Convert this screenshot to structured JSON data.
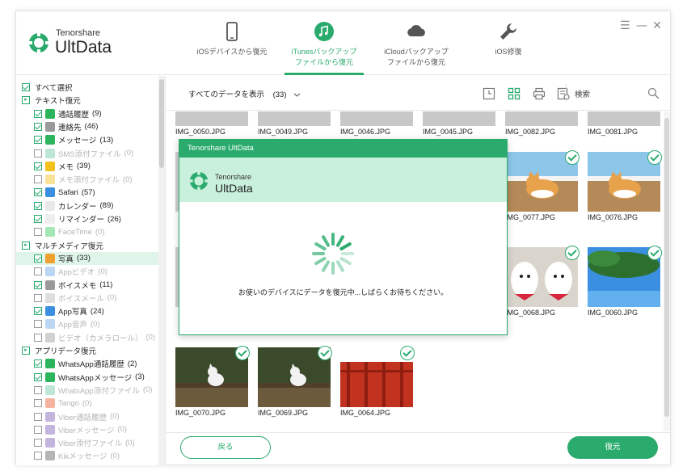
{
  "app": {
    "logo_small": "Tenorshare",
    "logo_big": "UltData"
  },
  "nav": {
    "tabs": [
      {
        "label": "iOSデバイスから復元",
        "icon": "phone-icon"
      },
      {
        "label": "iTunesバックアップ\nファイルから復元",
        "icon": "music-note-icon",
        "active": true
      },
      {
        "label": "iCloudバックアップ\nファイルから復元",
        "icon": "cloud-icon"
      },
      {
        "label": "iOS修復",
        "icon": "wrench-icon"
      }
    ]
  },
  "window_controls": {
    "menu": "☰",
    "minimize": "—",
    "close": "✕"
  },
  "sidebar": {
    "select_all": "すべて選択",
    "sections": [
      {
        "label": "テキスト復元",
        "items": [
          {
            "label": "通話履歴",
            "count": "(9)",
            "checked": true,
            "enabled": true,
            "icon_color": "#2db55d"
          },
          {
            "label": "連絡先",
            "count": "(46)",
            "checked": true,
            "enabled": true,
            "icon_color": "#9a9a9a"
          },
          {
            "label": "メッセージ",
            "count": "(13)",
            "checked": true,
            "enabled": true,
            "icon_color": "#2db55d"
          },
          {
            "label": "SMS添付ファイル",
            "count": "(0)",
            "checked": false,
            "enabled": false,
            "icon_color": "#6fc8a0"
          },
          {
            "label": "メモ",
            "count": "(39)",
            "checked": true,
            "enabled": true,
            "icon_color": "#f3c11b"
          },
          {
            "label": "メモ添付ファイル",
            "count": "(0)",
            "checked": false,
            "enabled": false,
            "icon_color": "#f3c11b"
          },
          {
            "label": "Safari",
            "count": "(57)",
            "checked": true,
            "enabled": true,
            "icon_color": "#3b8fe0"
          },
          {
            "label": "カレンダー",
            "count": "(89)",
            "checked": true,
            "enabled": true,
            "icon_color": "#e8e8e8"
          },
          {
            "label": "リマインダー",
            "count": "(26)",
            "checked": true,
            "enabled": true,
            "icon_color": "#eeeeee"
          },
          {
            "label": "FaceTime",
            "count": "(0)",
            "checked": false,
            "enabled": false,
            "icon_color": "#35c759"
          }
        ]
      },
      {
        "label": "マルチメディア復元",
        "items": [
          {
            "label": "写真",
            "count": "(33)",
            "checked": true,
            "enabled": true,
            "selected": true,
            "icon_color": "#f0a030"
          },
          {
            "label": "Appビデオ",
            "count": "(0)",
            "checked": false,
            "enabled": false,
            "icon_color": "#6aa7e6"
          },
          {
            "label": "ボイスメモ",
            "count": "(11)",
            "checked": true,
            "enabled": true,
            "icon_color": "#9a9a9a"
          },
          {
            "label": "ボイスメール",
            "count": "(0)",
            "checked": false,
            "enabled": false,
            "icon_color": "#b9b9b9"
          },
          {
            "label": "App写真",
            "count": "(24)",
            "checked": true,
            "enabled": true,
            "icon_color": "#3b8fe0"
          },
          {
            "label": "App音声",
            "count": "(0)",
            "checked": false,
            "enabled": false,
            "icon_color": "#6aa7e6"
          },
          {
            "label": "ビデオ（カメラロール）",
            "count": "(0)",
            "checked": false,
            "enabled": false,
            "icon_color": "#9a9a9a"
          }
        ]
      },
      {
        "label": "アプリデータ復元",
        "items": [
          {
            "label": "WhatsApp通話履歴",
            "count": "(2)",
            "checked": true,
            "enabled": true,
            "icon_color": "#2db55d"
          },
          {
            "label": "WhatsAppメッセージ",
            "count": "(3)",
            "checked": true,
            "enabled": true,
            "icon_color": "#2db55d"
          },
          {
            "label": "WhatsApp添付ファイル",
            "count": "(0)",
            "checked": false,
            "enabled": false,
            "icon_color": "#6fc8a0"
          },
          {
            "label": "Tango",
            "count": "(0)",
            "checked": false,
            "enabled": false,
            "icon_color": "#e8542b"
          },
          {
            "label": "Viber通話履歴",
            "count": "(0)",
            "checked": false,
            "enabled": false,
            "icon_color": "#7b5bb6"
          },
          {
            "label": "Viberメッセージ",
            "count": "(0)",
            "checked": false,
            "enabled": false,
            "icon_color": "#7b5bb6"
          },
          {
            "label": "Viber添付ファイル",
            "count": "(0)",
            "checked": false,
            "enabled": false,
            "icon_color": "#7b5bb6"
          },
          {
            "label": "Kikメッセージ",
            "count": "(0)",
            "checked": false,
            "enabled": false,
            "icon_color": "#5a5a5a"
          }
        ]
      }
    ]
  },
  "toolbar": {
    "filter_label": "すべてのデータを表示",
    "filter_count": "(33)",
    "search_placeholder": "検索"
  },
  "photos": {
    "top_row_names": [
      "IMG_0050.JPG",
      "IMG_0049.JPG",
      "IMG_0046.JPG",
      "IMG_0045.JPG",
      "IMG_0082.JPG",
      "IMG_0081.JPG"
    ],
    "rows": [
      [
        {
          "name": "IMG_0077.JPG",
          "kind": "cat-floor"
        },
        {
          "name": "IMG_0076.JPG",
          "kind": "cat-floor"
        }
      ],
      [
        {
          "name": "IMG_0068.JPG",
          "kind": "dogs"
        },
        {
          "name": "IMG_0060.JPG",
          "kind": "sky-tree"
        }
      ],
      [
        {
          "name": "IMG_0070.JPG",
          "kind": "cat-grass"
        },
        {
          "name": "IMG_0069.JPG",
          "kind": "cat-grass"
        },
        {
          "name": "IMG_0064.JPG",
          "kind": "shrine"
        }
      ]
    ]
  },
  "buttons": {
    "back": "戻る",
    "recover": "復元"
  },
  "modal": {
    "title": "Tenorshare UltData",
    "logo_small": "Tenorshare",
    "logo_big": "UltData",
    "message": "お使いのデバイスにデータを復元中...しばらくお待ちください。"
  },
  "colors": {
    "accent": "#2aab6d",
    "modal_band": "#c9f0dc",
    "selected_row": "#dff5e9"
  }
}
